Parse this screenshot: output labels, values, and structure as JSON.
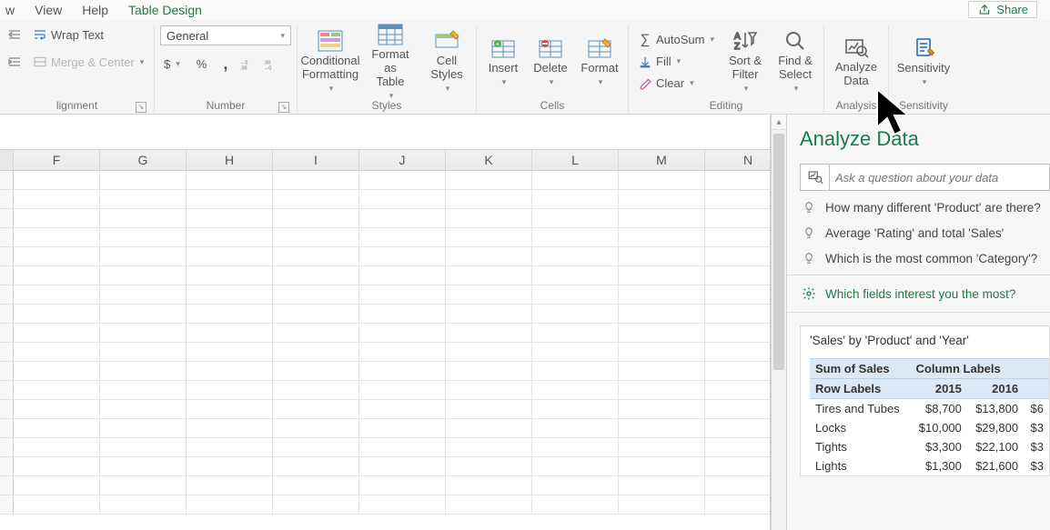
{
  "menu": {
    "view": "View",
    "help": "Help",
    "active_tab": "Table Design",
    "left_fragment": "w"
  },
  "share": {
    "label": "Share"
  },
  "ribbon": {
    "alignment": {
      "wrap": "Wrap Text",
      "merge": "Merge & Center",
      "group": "lignment"
    },
    "number": {
      "format_selected": "General",
      "currency": "$",
      "percent": "%",
      "comma": ",",
      "inc_dec": "←0 .00",
      "dec_dec": ".00 →0",
      "group": "Number"
    },
    "styles": {
      "cond_fmt": "Conditional\nFormatting",
      "fmt_table": "Format as\nTable",
      "cell_styles": "Cell\nStyles",
      "group": "Styles"
    },
    "cells": {
      "insert": "Insert",
      "delete": "Delete",
      "format": "Format",
      "group": "Cells"
    },
    "editing": {
      "autosum": "AutoSum",
      "fill": "Fill",
      "clear": "Clear",
      "sort_filter": "Sort &\nFilter",
      "find_select": "Find &\nSelect",
      "group": "Editing"
    },
    "analysis": {
      "analyze": "Analyze\nData",
      "group": "Analysis"
    },
    "sensitivity": {
      "sensitivity": "Sensitivity",
      "group": "Sensitivity"
    }
  },
  "columns": [
    "F",
    "G",
    "H",
    "I",
    "J",
    "K",
    "L",
    "M",
    "N"
  ],
  "pane": {
    "title": "Analyze Data",
    "search_placeholder": "Ask a question about your data",
    "suggestions": [
      "How many different 'Product' are there?",
      "Average 'Rating' and total 'Sales'",
      "Which is the most common 'Category'?"
    ],
    "fields_link": "Which fields interest you the most?",
    "insight": {
      "title": "'Sales' by 'Product' and 'Year'",
      "sum_label": "Sum of Sales",
      "col_label": "Column Labels",
      "row_label": "Row Labels",
      "years": [
        "2015",
        "2016",
        ""
      ],
      "rows": [
        {
          "product": "Tires and Tubes",
          "v": [
            "$8,700",
            "$13,800",
            "$6"
          ]
        },
        {
          "product": "Locks",
          "v": [
            "$10,000",
            "$29,800",
            "$3"
          ]
        },
        {
          "product": "Tights",
          "v": [
            "$3,300",
            "$22,100",
            "$3"
          ]
        },
        {
          "product": "Lights",
          "v": [
            "$1,300",
            "$21,600",
            "$3"
          ]
        }
      ]
    }
  }
}
